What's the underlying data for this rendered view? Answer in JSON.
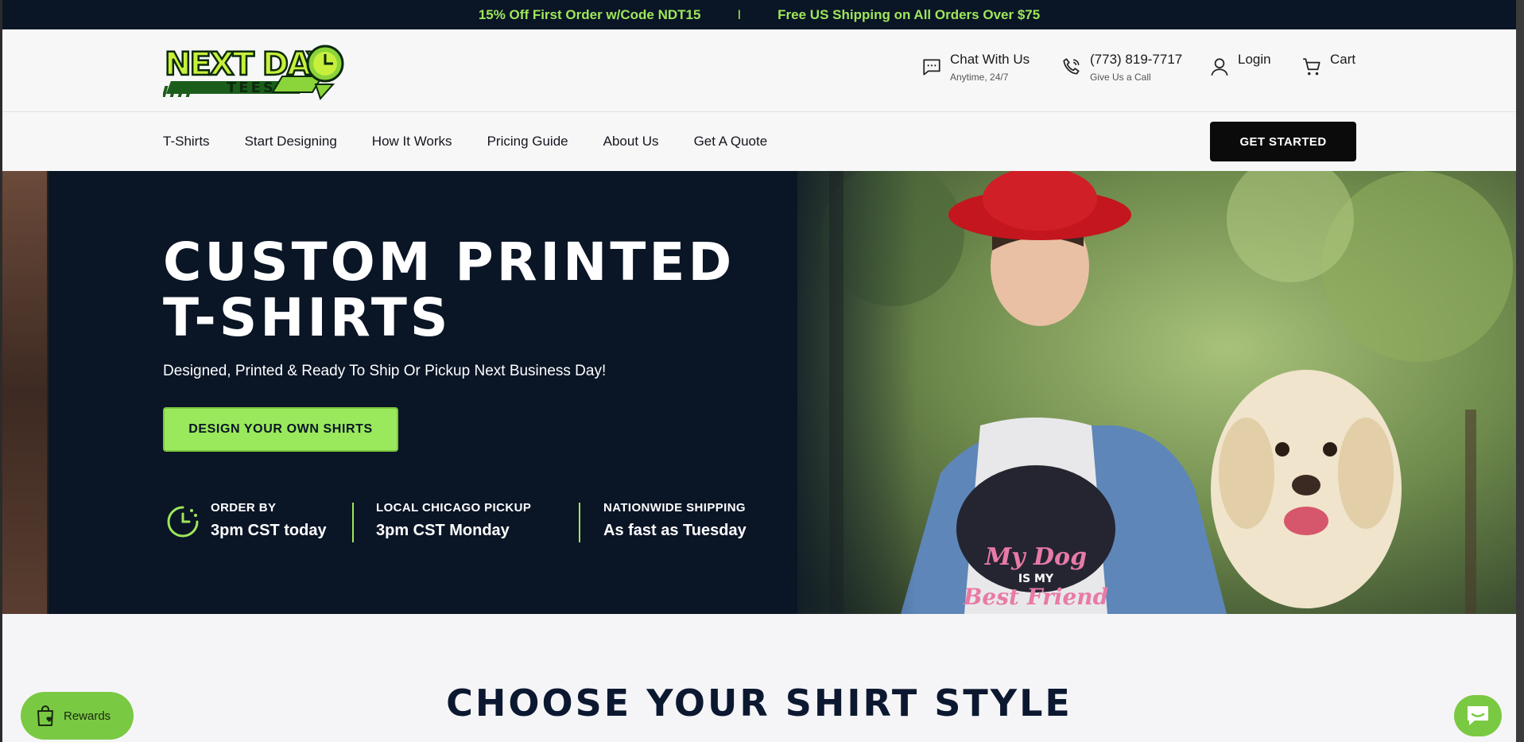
{
  "announcement": {
    "left": "15% Off First Order w/Code NDT15",
    "separator": "I",
    "right": "Free US Shipping on All Orders Over $75"
  },
  "header": {
    "logo_text_top": "NEXT DAY",
    "logo_text_bottom": "TEES",
    "chat": {
      "title": "Chat With Us",
      "subtitle": "Anytime, 24/7"
    },
    "phone": {
      "title": "(773) 819-7717",
      "subtitle": "Give Us a Call"
    },
    "login": "Login",
    "cart": "Cart"
  },
  "nav": {
    "items": [
      "T-Shirts",
      "Start Designing",
      "How It Works",
      "Pricing Guide",
      "About Us",
      "Get A Quote"
    ],
    "cta": "GET STARTED"
  },
  "hero": {
    "title_line1": "CUSTOM PRINTED",
    "title_line2": "T-SHIRTS",
    "subtitle": "Designed, Printed & Ready To Ship Or Pickup Next Business Day!",
    "button": "DESIGN YOUR OWN SHIRTS",
    "features": [
      {
        "label": "ORDER BY",
        "value": "3pm CST today"
      },
      {
        "label": "LOCAL CHICAGO PICKUP",
        "value": "3pm CST Monday"
      },
      {
        "label": "NATIONWIDE SHIPPING",
        "value": "As fast as Tuesday"
      }
    ],
    "shirt_text": {
      "line1": "My Dog",
      "line2": "IS MY",
      "line3": "Best Friend"
    }
  },
  "section": {
    "title": "CHOOSE YOUR SHIRT STYLE"
  },
  "widgets": {
    "rewards": "Rewards"
  },
  "colors": {
    "navy": "#0a1526",
    "lime": "#9ee75a",
    "black": "#0b0b0b"
  }
}
